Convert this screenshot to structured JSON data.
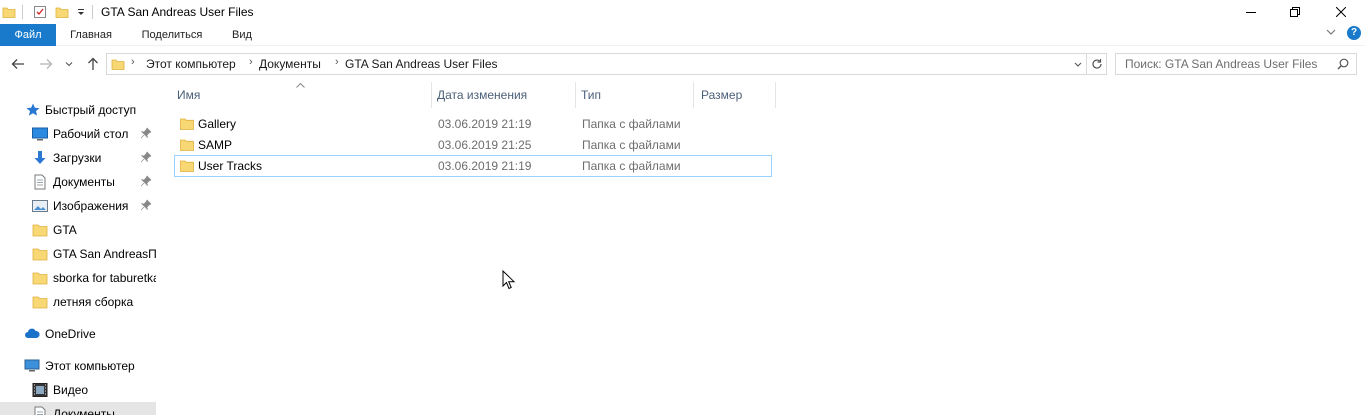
{
  "window": {
    "title": "GTA San Andreas User Files",
    "minimize_glyph": "─",
    "restore_glyph": "❐",
    "close_glyph": "✕"
  },
  "ribbon": {
    "tabs": [
      "Файл",
      "Главная",
      "Поделиться",
      "Вид"
    ],
    "expand_glyph": "﹀",
    "help_glyph": "?"
  },
  "address": {
    "crumbs": [
      "Этот компьютер",
      "Документы",
      "GTA San Andreas User Files"
    ],
    "search_placeholder": "Поиск: GTA San Andreas User Files"
  },
  "nav": {
    "items": [
      {
        "label": "Быстрый доступ",
        "icon": "star-icon",
        "pinned": false
      },
      {
        "label": "Рабочий стол",
        "icon": "desktop-icon",
        "pinned": true
      },
      {
        "label": "Загрузки",
        "icon": "download-icon",
        "pinned": true
      },
      {
        "label": "Документы",
        "icon": "document-icon",
        "pinned": true
      },
      {
        "label": "Изображения",
        "icon": "pictures-icon",
        "pinned": true
      },
      {
        "label": "GTA",
        "icon": "folder-icon",
        "pinned": false
      },
      {
        "label": "GTA San AndreasПр",
        "icon": "folder-icon",
        "pinned": false
      },
      {
        "label": "sborka for taburetka",
        "icon": "folder-icon",
        "pinned": false
      },
      {
        "label": "летняя сборка",
        "icon": "folder-icon",
        "pinned": false
      },
      {
        "label": "OneDrive",
        "icon": "cloud-icon",
        "pinned": false
      },
      {
        "label": "Этот компьютер",
        "icon": "computer-icon",
        "pinned": false
      },
      {
        "label": "Видео",
        "icon": "video-icon",
        "pinned": false
      },
      {
        "label": "Документы",
        "icon": "document-icon",
        "pinned": false
      }
    ]
  },
  "table": {
    "columns": [
      "Имя",
      "Дата изменения",
      "Тип",
      "Размер"
    ],
    "rows": [
      {
        "name": "Gallery",
        "date": "03.06.2019 21:19",
        "type": "Папка с файлами",
        "size": ""
      },
      {
        "name": "SAMP",
        "date": "03.06.2019 21:25",
        "type": "Папка с файлами",
        "size": ""
      },
      {
        "name": "User Tracks",
        "date": "03.06.2019 21:19",
        "type": "Папка с файлами",
        "size": ""
      }
    ],
    "focused_row": 2
  },
  "colors": {
    "accent": "#1979ca",
    "folder": "#f8d775",
    "folder_dark": "#e0b13f",
    "header_text": "#4c607a",
    "secondary_text": "#6d6d6d",
    "focus_border": "#99d1ff"
  }
}
